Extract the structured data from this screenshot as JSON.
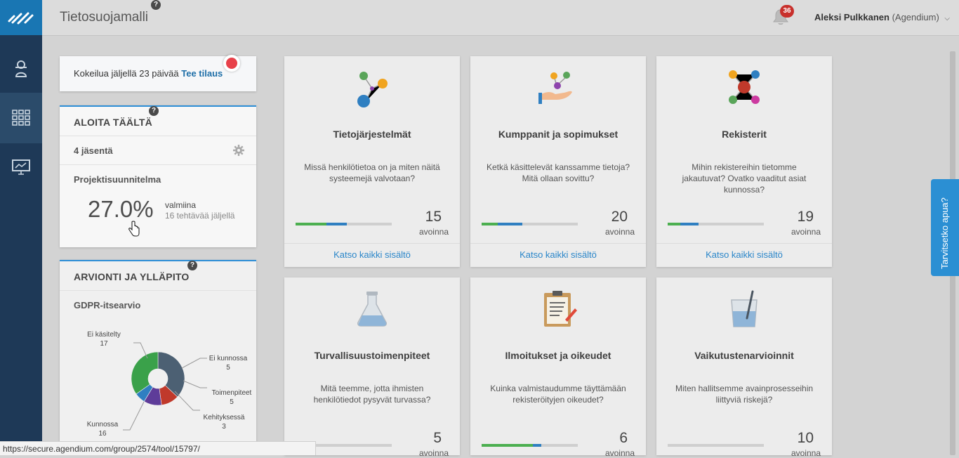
{
  "header": {
    "title": "Tietosuojamalli",
    "notification_count": "36",
    "user_name": "Aleksi Pulkkanen",
    "user_org": "(Agendium)"
  },
  "trial": {
    "text": "Kokeilua jäljellä 23 päivää",
    "link": "Tee tilaus"
  },
  "start_panel": {
    "title": "ALOITA TÄÄLTÄ",
    "members": "4 jäsentä",
    "project_label": "Projektisuunnitelma",
    "percent": "27.0%",
    "percent_label": "valmiina",
    "remaining": "16 tehtävää jäljellä"
  },
  "eval_panel": {
    "title": "ARVIONTI JA YLLÄPITO",
    "subtitle": "GDPR-itsearvio",
    "chart_data": {
      "type": "pie",
      "categories": [
        "Ei käsitelty",
        "Ei kunnossa",
        "Toimenpiteet",
        "Kehityksessä",
        "Kunnossa"
      ],
      "values": [
        17,
        5,
        5,
        3,
        16
      ],
      "colors": [
        "#4c6073",
        "#c0392b",
        "#5e3c99",
        "#2f7fc1",
        "#3aa14a"
      ],
      "labels": [
        {
          "name": "Ei käsitelty",
          "value": "17"
        },
        {
          "name": "Ei kunnossa",
          "value": "5"
        },
        {
          "name": "Toimenpiteet",
          "value": "5"
        },
        {
          "name": "Kehityksessä",
          "value": "3"
        },
        {
          "name": "Kunnossa",
          "value": "16"
        }
      ]
    }
  },
  "tiles": [
    {
      "title": "Tietojärjestelmät",
      "desc": "Missä henkilötietoa on ja miten näitä systeemejä valvotaan?",
      "count": "15",
      "count_label": "avoinna",
      "link": "Katso kaikki sisältö",
      "green": 0.32,
      "blue": 0.21
    },
    {
      "title": "Kumppanit ja sopimukset",
      "desc": "Ketkä käsittelevät kanssamme tietoja? Mitä ollaan sovittu?",
      "count": "20",
      "count_label": "avoinna",
      "link": "Katso kaikki sisältö",
      "green": 0.17,
      "blue": 0.25
    },
    {
      "title": "Rekisterit",
      "desc": "Mihin rekistereihin tietomme jakautuvat? Ovatko vaaditut asiat kunnossa?",
      "count": "19",
      "count_label": "avoinna",
      "link": "Katso kaikki sisältö",
      "green": 0.13,
      "blue": 0.19
    },
    {
      "title": "Turvallisuustoimenpiteet",
      "desc": "Mitä teemme, jotta ihmisten henkilötiedot pysyvät turvassa?",
      "count": "5",
      "count_label": "avoinna",
      "link": "",
      "green": 0.0,
      "blue": 0.2
    },
    {
      "title": "Ilmoitukset ja oikeudet",
      "desc": "Kuinka valmistaudumme täyttämään rekisteröityjen oikeudet?",
      "count": "6",
      "count_label": "avoinna",
      "link": "",
      "green": 0.53,
      "blue": 0.09
    },
    {
      "title": "Vaikutustenarvioinnit",
      "desc": "Miten hallitsemme avainprosesseihin liittyviä riskejä?",
      "count": "10",
      "count_label": "avoinna",
      "link": "",
      "green": 0.0,
      "blue": 0.0
    }
  ],
  "help_tab": "Tarvitsetko apua?",
  "status_url": "https://secure.agendium.com/group/2574/tool/15797/"
}
